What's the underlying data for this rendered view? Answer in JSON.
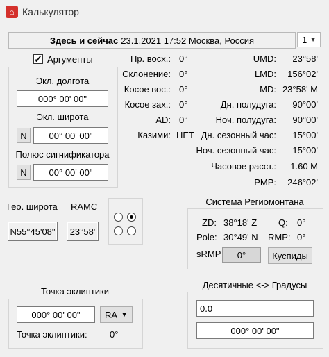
{
  "window": {
    "title": "Калькулятор"
  },
  "header": {
    "label": "Здесь и сейчас",
    "value": "23.1.2021 17:52 Москва, Россия",
    "spin": "1"
  },
  "arguments": {
    "checkbox_label": "Аргументы",
    "ecl_longitude_label": "Экл. долгота",
    "ecl_longitude_value": "000° 00' 00\"",
    "ecl_latitude_label": "Экл. широта",
    "ecl_latitude_ns": "N",
    "ecl_latitude_value": "00° 00' 00\"",
    "significator_pole_label": "Полюс сигнификатора",
    "pole_ns": "N",
    "pole_value": "00° 00' 00\""
  },
  "geo": {
    "latitude_label": "Гео. широта",
    "latitude_value": "N55°45'08\"",
    "ramc_label": "RAMC",
    "ramc_value": "23°58'"
  },
  "mid_stats": [
    {
      "label": "Пр. восх.:",
      "value": "0°"
    },
    {
      "label": "Склонение:",
      "value": "0°"
    },
    {
      "label": "Косое вос.:",
      "value": "0°"
    },
    {
      "label": "Косое зах.:",
      "value": "0°"
    },
    {
      "label": "AD:",
      "value": "0°"
    },
    {
      "label": "Казими:",
      "value": "НЕТ"
    }
  ],
  "right_stats": [
    {
      "label": "UMD:",
      "value": "23°58'"
    },
    {
      "label": "LMD:",
      "value": "156°02'"
    },
    {
      "label": "MD:",
      "value": "23°58' M"
    },
    {
      "label": "Дн. полудуга:",
      "value": "90°00'"
    },
    {
      "label": "Ноч. полудуга:",
      "value": "90°00'"
    },
    {
      "label": "Дн. сезонный час:",
      "value": "15°00'"
    },
    {
      "label": "Ноч. сезонный час:",
      "value": "15°00'"
    },
    {
      "label": "Часовое расст.:",
      "value": "1.60 M"
    },
    {
      "label": "PMP:",
      "value": "246°02'"
    }
  ],
  "regiomontanus": {
    "title": "Система Региомонтана",
    "zd_label": "ZD:",
    "zd_value": "38°18' Z",
    "q_label": "Q:",
    "q_value": "0°",
    "pole_label": "Pole:",
    "pole_value": "30°49' N",
    "rmp_label": "RMP:",
    "rmp_value": "0°",
    "srmp_label": "sRMP",
    "srmp_value": "0°",
    "cusps_button": "Куспиды"
  },
  "ecliptic_point": {
    "title": "Точка эклиптики",
    "value": "000° 00' 00\"",
    "mode": "RA",
    "result_label": "Точка эклиптики:",
    "result_value": "0°"
  },
  "decimal": {
    "title": "Десятичные <-> Градусы",
    "decimal_value": "0.0",
    "degrees_value": "000° 00' 00\""
  },
  "colors": {
    "app_icon": "#d4302b",
    "background": "#f0f0f0"
  }
}
